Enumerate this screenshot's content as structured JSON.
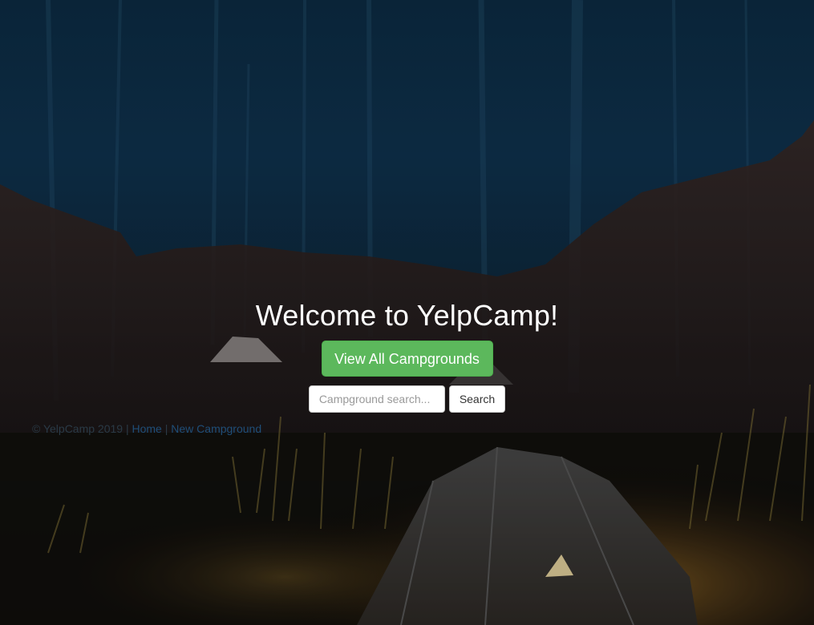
{
  "hero": {
    "title": "Welcome to YelpCamp!",
    "cta_label": "View All Campgrounds"
  },
  "search": {
    "placeholder": "Campground search...",
    "value": "",
    "button_label": "Search"
  },
  "footer": {
    "copyright": "© YelpCamp 2019",
    "sep1": "|",
    "home_label": "Home",
    "sep2": "|",
    "new_campground_label": "New Campground"
  },
  "colors": {
    "cta_background": "#5cb85c",
    "overlay": "#0d2d45",
    "link": "#1f4e78"
  },
  "background_image": "night-campsite-forest-photo"
}
